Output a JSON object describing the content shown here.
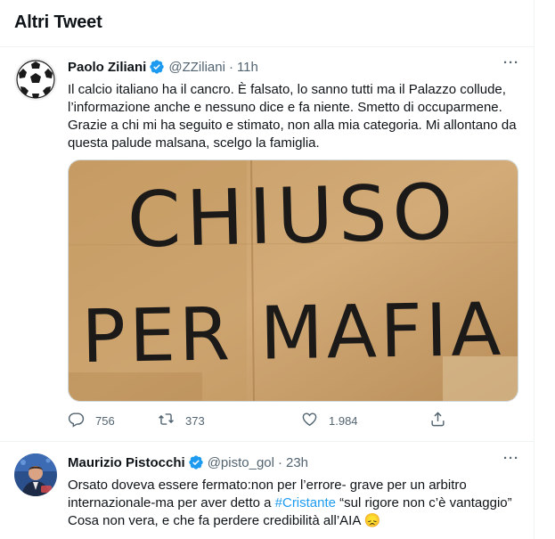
{
  "section": {
    "title": "Altri Tweet"
  },
  "tweets": [
    {
      "author": "Paolo Ziliani",
      "handle": "@ZZiliani",
      "separator": "·",
      "time": "11h",
      "more": "···",
      "text": "Il calcio italiano ha il cancro. È falsato, lo sanno tutti ma il Palazzo collude, l’informazione anche e nessuno dice e fa niente. Smetto di occuparmene. Grazie a chi mi ha seguito e stimato, non alla mia categoria. Mi allontano da questa palude malsana, scelgo la famiglia.",
      "media": {
        "line1": "CHIUSO",
        "line2": "PER MAFIA"
      },
      "stats": {
        "replies": "756",
        "retweets": "373",
        "likes": "1.984"
      }
    },
    {
      "author": "Maurizio Pistocchi",
      "handle": "@pisto_gol",
      "separator": "·",
      "time": "23h",
      "more": "···",
      "text_before": "Orsato doveva essere fermato:non per l’errore- grave per un arbitro internazionale-ma per aver detto a ",
      "hashtag": "#Cristante",
      "text_after": " “sul rigore non c’è vantaggio” Cosa  non vera, e che fa perdere credibilità all’AIA",
      "emoji": "😞"
    }
  ],
  "icons": {
    "verified": "verified-badge-icon",
    "reply": "reply-icon",
    "retweet": "retweet-icon",
    "like": "heart-icon",
    "share": "share-icon"
  },
  "colors": {
    "accent": "#1d9bf0",
    "text": "#0f1419",
    "secondary": "#536471",
    "border": "#eff3f4"
  }
}
